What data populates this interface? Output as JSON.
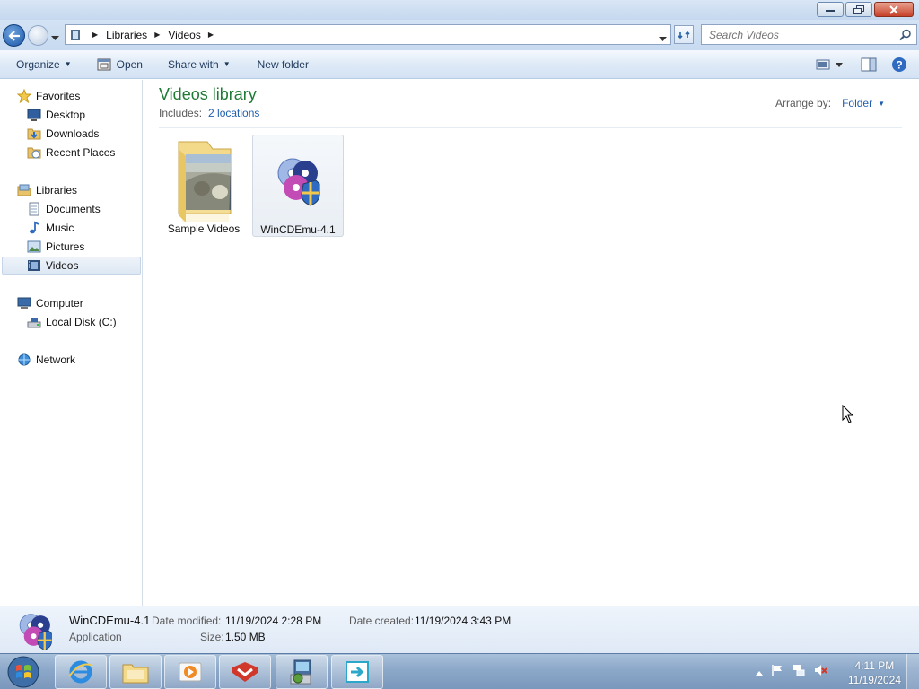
{
  "window": {
    "controls": {
      "minimize": "minimize",
      "restore": "restore",
      "close": "close"
    }
  },
  "address": {
    "breadcrumbs": [
      "Libraries",
      "Videos"
    ],
    "search_placeholder": "Search Videos"
  },
  "toolbar": {
    "organize": "Organize",
    "open": "Open",
    "share_with": "Share with",
    "new_folder": "New folder"
  },
  "nav": {
    "favorites": "Favorites",
    "desktop": "Desktop",
    "downloads": "Downloads",
    "recent_places": "Recent Places",
    "libraries": "Libraries",
    "documents": "Documents",
    "music": "Music",
    "pictures": "Pictures",
    "videos": "Videos",
    "computer": "Computer",
    "local_disk": "Local Disk (C:)",
    "network": "Network"
  },
  "library": {
    "title": "Videos library",
    "includes_label": "Includes:",
    "includes_link": "2 locations",
    "arrange_label": "Arrange by:",
    "arrange_value": "Folder"
  },
  "items": [
    {
      "name": "Sample Videos",
      "icon": "folder-with-photo-icon"
    },
    {
      "name": "WinCDEmu-4.1",
      "icon": "wincdemu-disc-shield-icon"
    }
  ],
  "details": {
    "name": "WinCDEmu-4.1",
    "type": "Application",
    "date_modified_label": "Date modified:",
    "date_modified": "11/19/2024 2:28 PM",
    "date_created_label": "Date created:",
    "date_created": "11/19/2024 3:43 PM",
    "size_label": "Size:",
    "size": "1.50 MB"
  },
  "taskbar": {
    "time": "4:11 PM",
    "date": "11/19/2024"
  },
  "colors": {
    "library_title": "#1e7a34",
    "link": "#1f5fae"
  }
}
